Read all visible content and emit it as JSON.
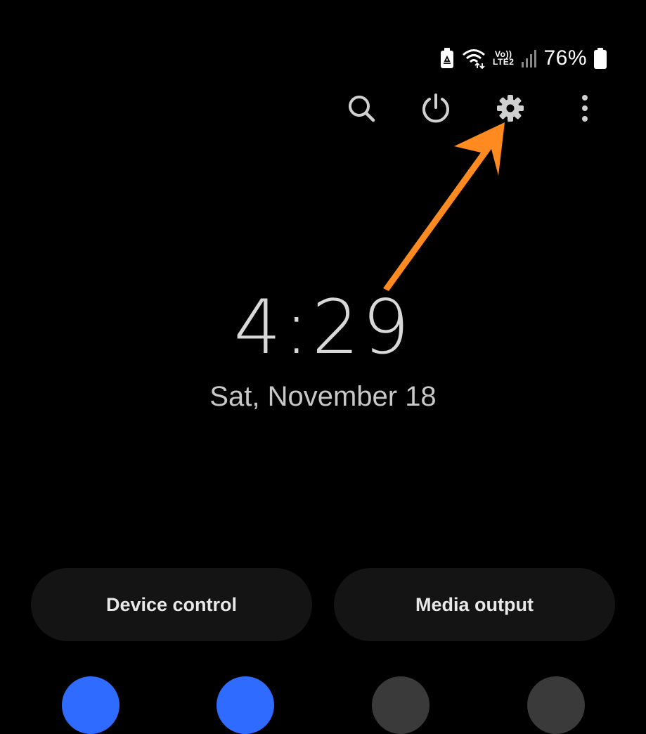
{
  "status": {
    "volte_top": "Vo))",
    "volte_bottom": "LTE2",
    "battery_percent": "76%",
    "icons": [
      "battery-saver-icon",
      "wifi-icon",
      "volte-icon",
      "signal-icon",
      "battery-icon"
    ]
  },
  "toolbar": {
    "icons": [
      "search-icon",
      "power-icon",
      "gear-icon",
      "more-vert-icon"
    ]
  },
  "clock": {
    "time": "4:29",
    "date": "Sat, November 18"
  },
  "buttons": {
    "device_control": "Device control",
    "media_output": "Media output"
  },
  "tiles": {
    "colors": [
      "#2f6bff",
      "#2f6bff",
      "#3a3a3a",
      "#3a3a3a"
    ]
  },
  "annotation": {
    "arrow_color": "#ff8a1f"
  },
  "colors": {
    "background": "#000000",
    "pill": "#141414",
    "text": "#e6e6e6"
  }
}
